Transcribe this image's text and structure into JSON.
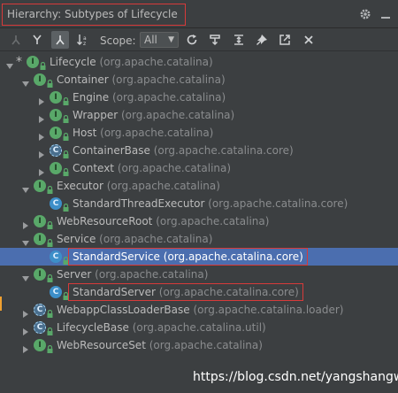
{
  "title": {
    "label": "Hierarchy:",
    "subject": "Subtypes of Lifecycle"
  },
  "icons": {
    "settings": "gear-icon",
    "minimize": "minimize-icon"
  },
  "toolbar": {
    "scope_label": "Scope:",
    "scope_value": "All"
  },
  "tree": [
    {
      "indent": 0,
      "arrow": "down",
      "star": true,
      "kind": "I",
      "name": "Lifecycle",
      "pkg": "(org.apache.catalina)"
    },
    {
      "indent": 1,
      "arrow": "down",
      "kind": "I",
      "name": "Container",
      "pkg": "(org.apache.catalina)"
    },
    {
      "indent": 2,
      "arrow": "right",
      "kind": "I",
      "name": "Engine",
      "pkg": "(org.apache.catalina)"
    },
    {
      "indent": 2,
      "arrow": "right",
      "kind": "I",
      "name": "Wrapper",
      "pkg": "(org.apache.catalina)"
    },
    {
      "indent": 2,
      "arrow": "right",
      "kind": "I",
      "name": "Host",
      "pkg": "(org.apache.catalina)"
    },
    {
      "indent": 2,
      "arrow": "right",
      "kind": "CA",
      "name": "ContainerBase",
      "pkg": "(org.apache.catalina.core)"
    },
    {
      "indent": 2,
      "arrow": "right",
      "kind": "I",
      "name": "Context",
      "pkg": "(org.apache.catalina)"
    },
    {
      "indent": 1,
      "arrow": "down",
      "kind": "I",
      "name": "Executor",
      "pkg": "(org.apache.catalina)"
    },
    {
      "indent": 2,
      "arrow": "none",
      "kind": "C",
      "name": "StandardThreadExecutor",
      "pkg": "(org.apache.catalina.core)"
    },
    {
      "indent": 1,
      "arrow": "right",
      "kind": "I",
      "name": "WebResourceRoot",
      "pkg": "(org.apache.catalina)"
    },
    {
      "indent": 1,
      "arrow": "down",
      "kind": "I",
      "name": "Service",
      "pkg": "(org.apache.catalina)"
    },
    {
      "indent": 2,
      "arrow": "none",
      "kind": "C",
      "name": "StandardService",
      "pkg": "(org.apache.catalina.core)",
      "selected": true,
      "boxed": true
    },
    {
      "indent": 1,
      "arrow": "down",
      "kind": "I",
      "name": "Server",
      "pkg": "(org.apache.catalina)"
    },
    {
      "indent": 2,
      "arrow": "none",
      "kind": "C",
      "name": "StandardServer",
      "pkg": "(org.apache.catalina.core)",
      "boxed": true
    },
    {
      "indent": 1,
      "arrow": "right",
      "kind": "CA",
      "name": "WebappClassLoaderBase",
      "pkg": "(org.apache.catalina.loader)"
    },
    {
      "indent": 1,
      "arrow": "right",
      "kind": "CA",
      "name": "LifecycleBase",
      "pkg": "(org.apache.catalina.util)"
    },
    {
      "indent": 1,
      "arrow": "right",
      "kind": "I",
      "name": "WebResourceSet",
      "pkg": "(org.apache.catalina)"
    }
  ],
  "watermark": "https://blog.csdn.net/yangshangwei"
}
